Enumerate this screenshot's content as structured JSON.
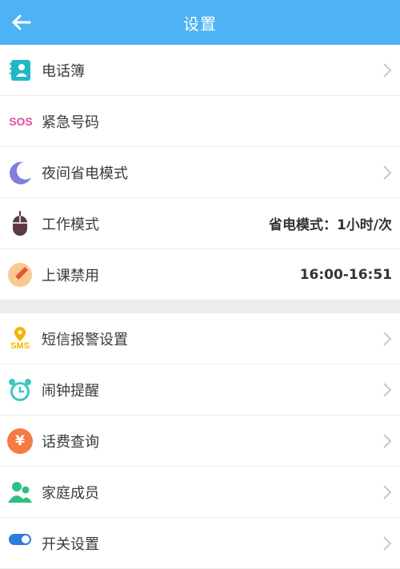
{
  "header": {
    "title": "设置"
  },
  "section1": [
    {
      "label": "电话簿",
      "icon": "contacts-icon",
      "has_arrow": true,
      "value": ""
    },
    {
      "label": "紧急号码",
      "icon": "sos-icon",
      "icon_text": "SOS",
      "has_arrow": false,
      "value": ""
    },
    {
      "label": "夜间省电模式",
      "icon": "moon-icon",
      "has_arrow": true,
      "value": ""
    },
    {
      "label": "工作模式",
      "icon": "mouse-icon",
      "has_arrow": false,
      "value": "省电模式：1小时/次"
    },
    {
      "label": "上课禁用",
      "icon": "pencil-icon",
      "has_arrow": false,
      "value": "16:00-16:51"
    }
  ],
  "section2": [
    {
      "label": "短信报警设置",
      "icon": "sms-location-icon",
      "icon_text": "SMS",
      "has_arrow": true
    },
    {
      "label": "闹钟提醒",
      "icon": "alarm-clock-icon",
      "has_arrow": true
    },
    {
      "label": "话费查询",
      "icon": "yuan-icon",
      "icon_text": "¥",
      "has_arrow": true
    },
    {
      "label": "家庭成员",
      "icon": "family-icon",
      "has_arrow": true
    },
    {
      "label": "开关设置",
      "icon": "toggle-icon",
      "has_arrow": true
    }
  ],
  "colors": {
    "header": "#4db3f4",
    "sos": "#e84a9e",
    "moon": "#7f7fe0",
    "mouse": "#5b3a4a",
    "pencil": "#f2a26b",
    "sms": "#f4b400",
    "alarm": "#3fc7c2",
    "yuan": "#f47b45",
    "family": "#2fbf85",
    "toggle": "#2b7de0"
  }
}
